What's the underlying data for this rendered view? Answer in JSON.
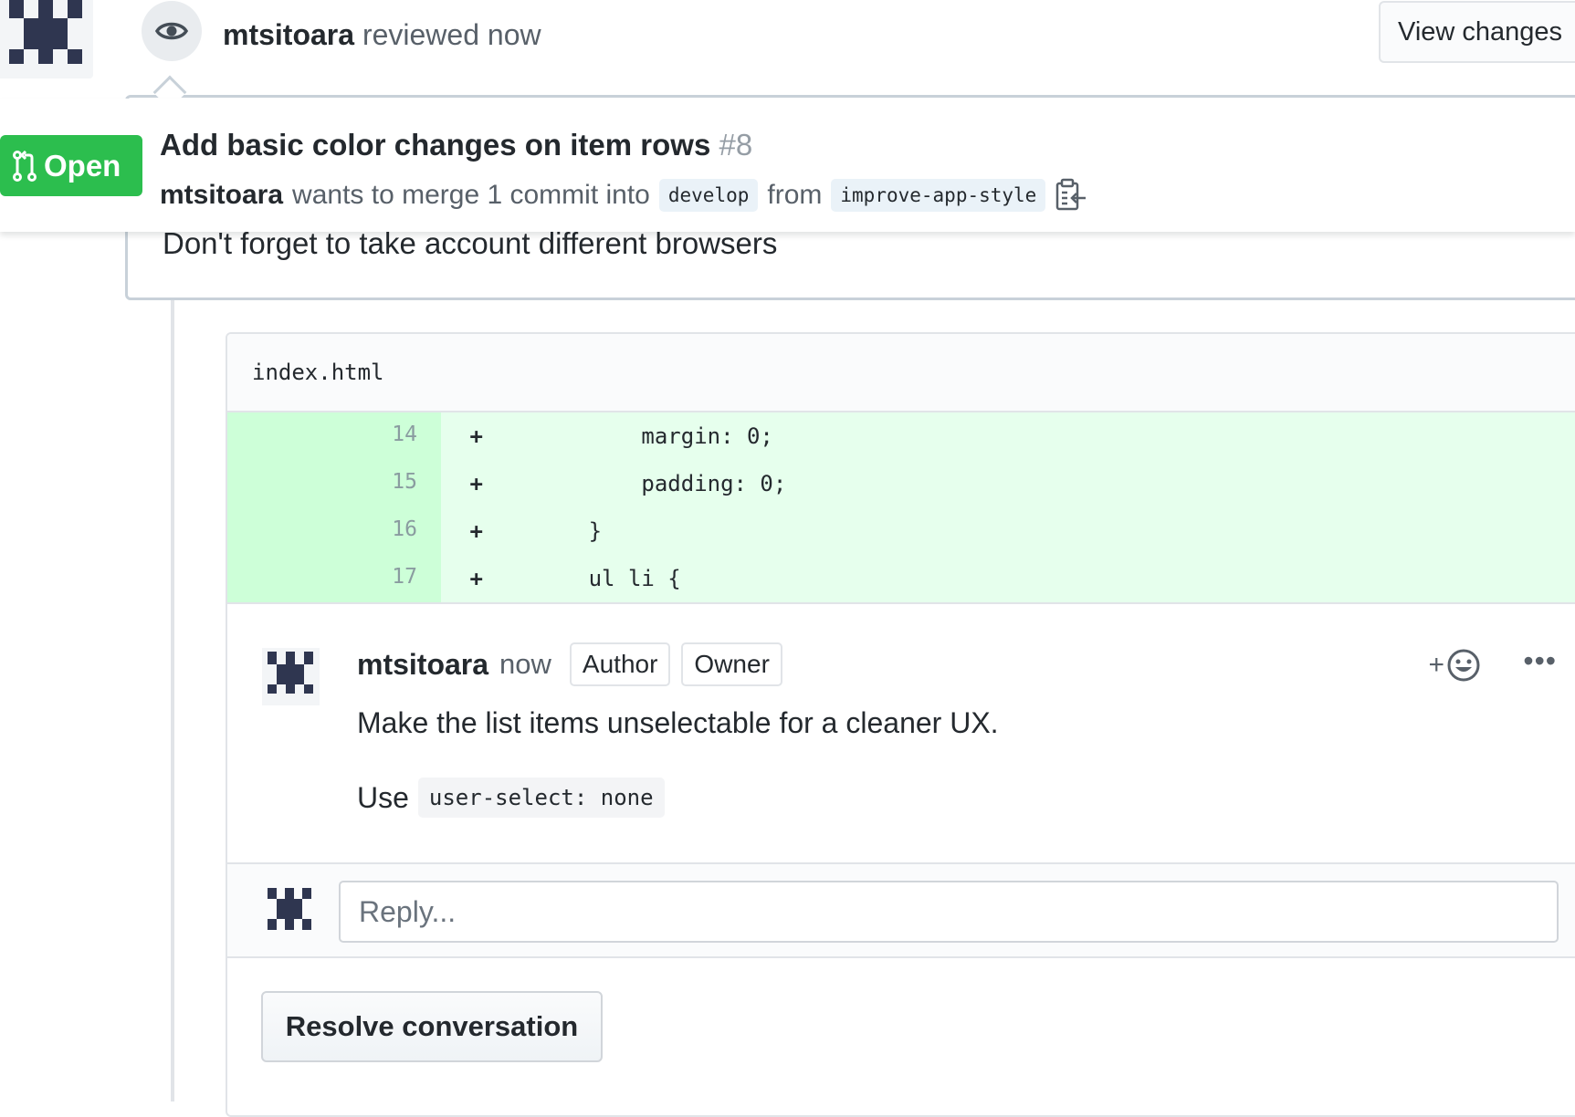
{
  "review_event": {
    "author": "mtsitoara",
    "action": "reviewed",
    "time": "now",
    "view_changes_label": "View changes",
    "icon": "eye-icon",
    "body": "Don't forget to take account different browsers"
  },
  "pr": {
    "status": "Open",
    "status_icon": "git-pull-request-icon",
    "status_color": "#2cbe4e",
    "title": "Add basic color changes on item rows",
    "number": "#8",
    "author": "mtsitoara",
    "merge_text": "wants to merge 1 commit into",
    "base_branch": "develop",
    "from_text": "from",
    "head_branch": "improve-app-style",
    "copy_icon": "clipboard-copy-icon"
  },
  "thread": {
    "file": "index.html",
    "diff_lines": [
      {
        "num": "14",
        "sign": "+",
        "code": "            margin: 0;"
      },
      {
        "num": "15",
        "sign": "+",
        "code": "            padding: 0;"
      },
      {
        "num": "16",
        "sign": "+",
        "code": "        }"
      },
      {
        "num": "17",
        "sign": "+",
        "code": "        ul li {"
      }
    ],
    "comment": {
      "author": "mtsitoara",
      "time": "now",
      "badges": [
        "Author",
        "Owner"
      ],
      "text": "Make the list items unselectable for a cleaner UX.",
      "use_text": "Use",
      "use_code": "user-select: none",
      "reaction_icon": "add-reaction-icon",
      "more_icon": "kebab-menu-icon"
    },
    "reply_placeholder": "Reply...",
    "resolve_label": "Resolve conversation"
  },
  "colors": {
    "added_line_bg": "#e6ffed",
    "added_num_bg": "#cdffd8",
    "avatar_fg": "#2f3650"
  }
}
